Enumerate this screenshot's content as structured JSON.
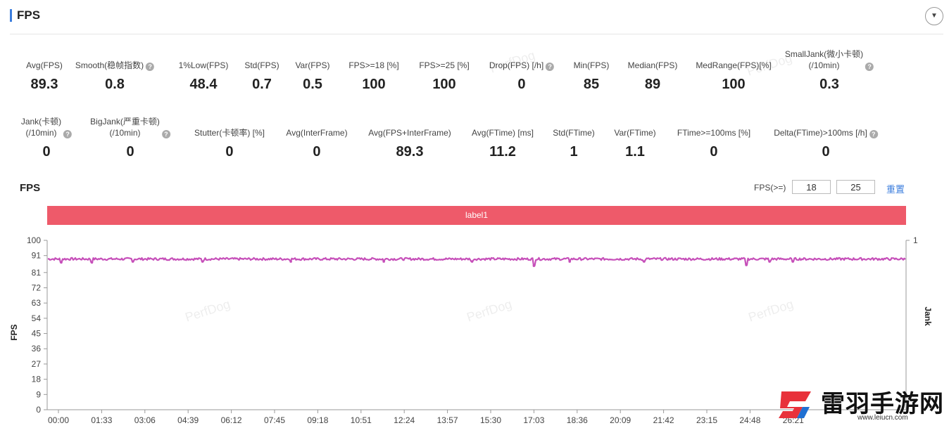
{
  "header": {
    "title": "FPS"
  },
  "metrics_row1": [
    {
      "label": "Avg(FPS)",
      "value": "89.3",
      "help": false
    },
    {
      "label": "Smooth(稳帧指数)",
      "value": "0.8",
      "help": true
    },
    {
      "label": "1%Low(FPS)",
      "value": "48.4",
      "help": false
    },
    {
      "label": "Std(FPS)",
      "value": "0.7",
      "help": false
    },
    {
      "label": "Var(FPS)",
      "value": "0.5",
      "help": false
    },
    {
      "label": "FPS>=18 [%]",
      "value": "100",
      "help": false
    },
    {
      "label": "FPS>=25 [%]",
      "value": "100",
      "help": false
    },
    {
      "label": "Drop(FPS) [/h]",
      "value": "0",
      "help": true
    },
    {
      "label": "Min(FPS)",
      "value": "85",
      "help": false
    },
    {
      "label": "Median(FPS)",
      "value": "89",
      "help": false
    },
    {
      "label": "MedRange(FPS)[%]",
      "value": "100",
      "help": false
    },
    {
      "label": "SmallJank(微小卡顿)\n(/10min)",
      "value": "0.3",
      "help": true
    }
  ],
  "metrics_row2": [
    {
      "label": "Jank(卡顿)\n(/10min)",
      "value": "0",
      "help": true
    },
    {
      "label": "BigJank(严重卡顿)\n(/10min)",
      "value": "0",
      "help": true
    },
    {
      "label": "Stutter(卡顿率) [%]",
      "value": "0",
      "help": false
    },
    {
      "label": "Avg(InterFrame)",
      "value": "0",
      "help": false
    },
    {
      "label": "Avg(FPS+InterFrame)",
      "value": "89.3",
      "help": false
    },
    {
      "label": "Avg(FTime) [ms]",
      "value": "11.2",
      "help": false
    },
    {
      "label": "Std(FTime)",
      "value": "1",
      "help": false
    },
    {
      "label": "Var(FTime)",
      "value": "1.1",
      "help": false
    },
    {
      "label": "FTime>=100ms [%]",
      "value": "0",
      "help": false
    },
    {
      "label": "Delta(FTime)>100ms [/h]",
      "value": "0",
      "help": true
    }
  ],
  "chart_controls": {
    "title": "FPS",
    "threshold_label": "FPS(>=)",
    "threshold_1": "18",
    "threshold_2": "25",
    "reset_label": "重置",
    "label_band": "label1"
  },
  "watermark": "PerfDog",
  "logo": {
    "name": "雷羽手游网",
    "url": "www.leiucn.com"
  },
  "colors": {
    "series": "#c64fb9",
    "band": "#ee5a6a",
    "accent": "#3b7ddd"
  },
  "chart_data": {
    "type": "line",
    "ylabel": "FPS",
    "y2label": "Jank",
    "ylim": [
      0,
      100
    ],
    "y2lim": [
      0,
      1
    ],
    "yticks": [
      0,
      9,
      18,
      27,
      36,
      45,
      54,
      63,
      72,
      81,
      91,
      100
    ],
    "y2ticks": [
      1
    ],
    "xticks": [
      "00:00",
      "01:33",
      "03:06",
      "04:39",
      "06:12",
      "07:45",
      "09:18",
      "10:51",
      "12:24",
      "13:57",
      "15:30",
      "17:03",
      "18:36",
      "20:09",
      "21:42",
      "23:15",
      "24:48",
      "26:21"
    ],
    "grid": false,
    "series": [
      {
        "name": "FPS",
        "color": "#c64fb9",
        "baseline": 89,
        "dips": [
          {
            "time": "00:06",
            "value": 87
          },
          {
            "time": "01:12",
            "value": 87
          },
          {
            "time": "02:40",
            "value": 87.5
          },
          {
            "time": "05:10",
            "value": 87.5
          },
          {
            "time": "08:20",
            "value": 87.5
          },
          {
            "time": "11:40",
            "value": 87.5
          },
          {
            "time": "14:50",
            "value": 87.5
          },
          {
            "time": "17:03",
            "value": 85
          },
          {
            "time": "18:20",
            "value": 87.5
          },
          {
            "time": "21:00",
            "value": 87.5
          },
          {
            "time": "24:40",
            "value": 85.5
          },
          {
            "time": "25:30",
            "value": 87.5
          },
          {
            "time": "26:20",
            "value": 87.5
          }
        ]
      }
    ]
  }
}
